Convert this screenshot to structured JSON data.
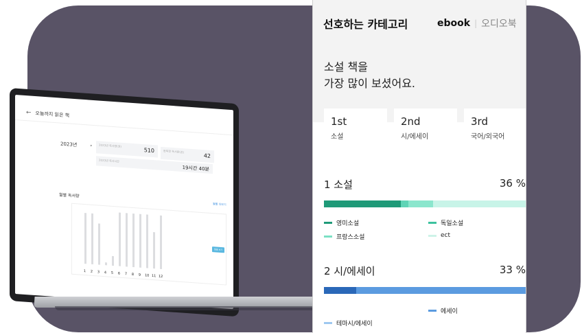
{
  "laptop": {
    "header_title": "오늘까지 읽은 책",
    "year_select": "2023년",
    "stat_books_label": "2023년 독서량(권)",
    "stat_books_value": "510",
    "stat_target_label": "완독한 독서량(권)",
    "stat_target_value": "42",
    "stat_time_label": "2023년 독서시간",
    "stat_time_value": "19시간 40분",
    "monthly_title": "월별 독서량",
    "monthly_link": "월별 더보기",
    "months": [
      "1",
      "2",
      "3",
      "4",
      "5",
      "6",
      "7",
      "8",
      "9",
      "10",
      "11",
      "12"
    ],
    "month_values": [
      42,
      42,
      34,
      2,
      8,
      44,
      44,
      44,
      44,
      44,
      30,
      44
    ],
    "tooltip": "월별 보기"
  },
  "panel": {
    "title": "선호하는 카테고리",
    "tab_ebook": "ebook",
    "tab_audio": "오디오북",
    "headline_line1": "소설 책을",
    "headline_line2": "가장 많이 보셨어요.",
    "ranks": [
      {
        "ord": "1st",
        "cat": "소설"
      },
      {
        "ord": "2nd",
        "cat": "시/에세이"
      },
      {
        "ord": "3rd",
        "cat": "국어/외국어"
      }
    ],
    "sections": [
      {
        "title": "1 소설",
        "percent": "36 %",
        "segments": [
          {
            "color": "#1f9a78",
            "share": 0.38
          },
          {
            "color": "#5fd4b6",
            "share": 0.04
          },
          {
            "color": "#8be6cd",
            "share": 0.12
          },
          {
            "color": "#c8f4e8",
            "share": 0.46
          }
        ],
        "legend": [
          {
            "label": "영미소설",
            "color": "#1f9a78"
          },
          {
            "label": "독일소설",
            "color": "#3cc29e"
          },
          {
            "label": "프랑스소설",
            "color": "#7be0c4"
          },
          {
            "label": "ect",
            "color": "#cdf3e8"
          }
        ]
      },
      {
        "title": "2 시/에세이",
        "percent": "33 %",
        "segments": [
          {
            "color": "#2a68b8",
            "share": 0.16
          },
          {
            "color": "#5b9be0",
            "share": 0.84
          }
        ],
        "legend": [
          {
            "label": "에세이",
            "color": "#5b9be0"
          },
          {
            "label": "테마시/에세이",
            "color": "#9ec8f0"
          }
        ]
      }
    ]
  }
}
